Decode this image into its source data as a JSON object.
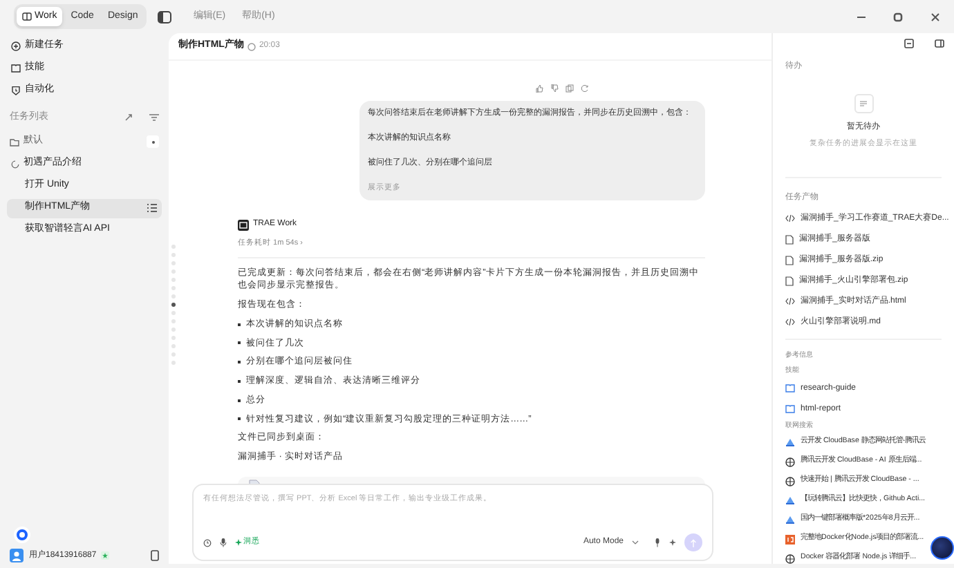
{
  "top_bar": {
    "modes": [
      {
        "label": "Work",
        "selected": true
      },
      {
        "label": "Code",
        "selected": false
      },
      {
        "label": "Design",
        "selected": false
      }
    ],
    "menus": [
      "编辑(E)",
      "帮助(H)"
    ]
  },
  "sidebar": {
    "nav": [
      {
        "label": "新建任务"
      },
      {
        "label": "技能"
      },
      {
        "label": "自动化"
      }
    ],
    "section_title": "任务列表",
    "folder": "默认",
    "tasks": [
      {
        "label": "初遇产品介绍",
        "selected": false,
        "running": true,
        "children": [
          {
            "label": "打开 Unity",
            "selected": false
          },
          {
            "label": "制作HTML产物",
            "selected": true
          },
          {
            "label": "获取智谱轻言AI API",
            "selected": false
          }
        ]
      }
    ],
    "user": "用户18413916887"
  },
  "main": {
    "title": "制作HTML产物",
    "time": "20:03",
    "user_message": {
      "lines": [
        "每次问答结束后在老师讲解下方生成一份完整的漏洞报告，并同步在历史回溯中，包含：",
        "本次讲解的知识点名称",
        "被问住了几次、分别在哪个追问层"
      ],
      "more": "展示更多"
    },
    "outline_dots": [
      {
        "selected": false
      },
      {
        "selected": false
      },
      {
        "selected": false
      },
      {
        "selected": false
      },
      {
        "selected": false
      },
      {
        "selected": false
      },
      {
        "selected": false
      },
      {
        "selected": true
      },
      {
        "selected": false
      },
      {
        "selected": false
      },
      {
        "selected": false
      },
      {
        "selected": false
      },
      {
        "selected": false
      },
      {
        "selected": false
      },
      {
        "selected": false
      }
    ],
    "agent": {
      "name": "TRAE Work",
      "duration": "任务耗时 1m 54s ›",
      "paragraphs": [
        "已完成更新：每次问答结束后，都会在右侧“老师讲解内容”卡片下方生成一份本轮漏洞报告，并且历史回溯中也会同步显示完整报告。",
        "报告现在包含："
      ],
      "bullets": [
        "本次讲解的知识点名称",
        "被问住了几次",
        "分别在哪个追问层被问住",
        "理解深度、逻辑自洽、表达清晰三维评分",
        "总分",
        "针对性复习建议，例如“建议重新复习勾股定理的三种证明方法……”"
      ],
      "after": [
        "文件已同步到桌面：",
        "漏洞捕手 · 实时对话产品"
      ]
    },
    "composer": {
      "placeholder": "有任何想法尽管说，撰写 PPT、分析 Excel 等日常工作，输出专业级工作成果。",
      "tag": "洞悉",
      "mode": "Auto Mode"
    }
  },
  "right": {
    "todo": {
      "title": "待办",
      "empty_title": "暂无待办",
      "empty_hint": "复杂任务的进展会显示在这里"
    },
    "outputs": {
      "title": "任务产物",
      "items": [
        {
          "label": "漏洞捕手_学习工作赛道_TRAE大赛De...",
          "kind": "code"
        },
        {
          "label": "漏洞捕手_服务器版",
          "kind": "file"
        },
        {
          "label": "漏洞捕手_服务器版.zip",
          "kind": "file"
        },
        {
          "label": "漏洞捕手_火山引擎部署包.zip",
          "kind": "file"
        },
        {
          "label": "漏洞捕手_实时对话产品.html",
          "kind": "code"
        },
        {
          "label": "火山引擎部署说明.md",
          "kind": "code"
        }
      ]
    },
    "refs": {
      "title": "参考信息",
      "skills_title": "技能",
      "skills": [
        "research-guide",
        "html-report"
      ],
      "search_title": "联网搜索",
      "results": [
        {
          "label": "云开发 CloudBase 静态网站托管-腾讯云",
          "kind": "cloud"
        },
        {
          "label": "腾讯云开发 CloudBase - AI 原生后端...",
          "kind": "globe"
        },
        {
          "label": "快速开始 | 腾讯云开发 CloudBase - ...",
          "kind": "globe"
        },
        {
          "label": "【玩转腾讯云】比快更快，Github Acti...",
          "kind": "cloud"
        },
        {
          "label": "国内一键部署概率版*2025年8月云开...",
          "kind": "cloud"
        },
        {
          "label": "完整地Docker化Node.js项目的部署流...",
          "kind": "js"
        },
        {
          "label": "Docker 容器化部署 Node.js 详细手...",
          "kind": "globe"
        }
      ]
    }
  }
}
